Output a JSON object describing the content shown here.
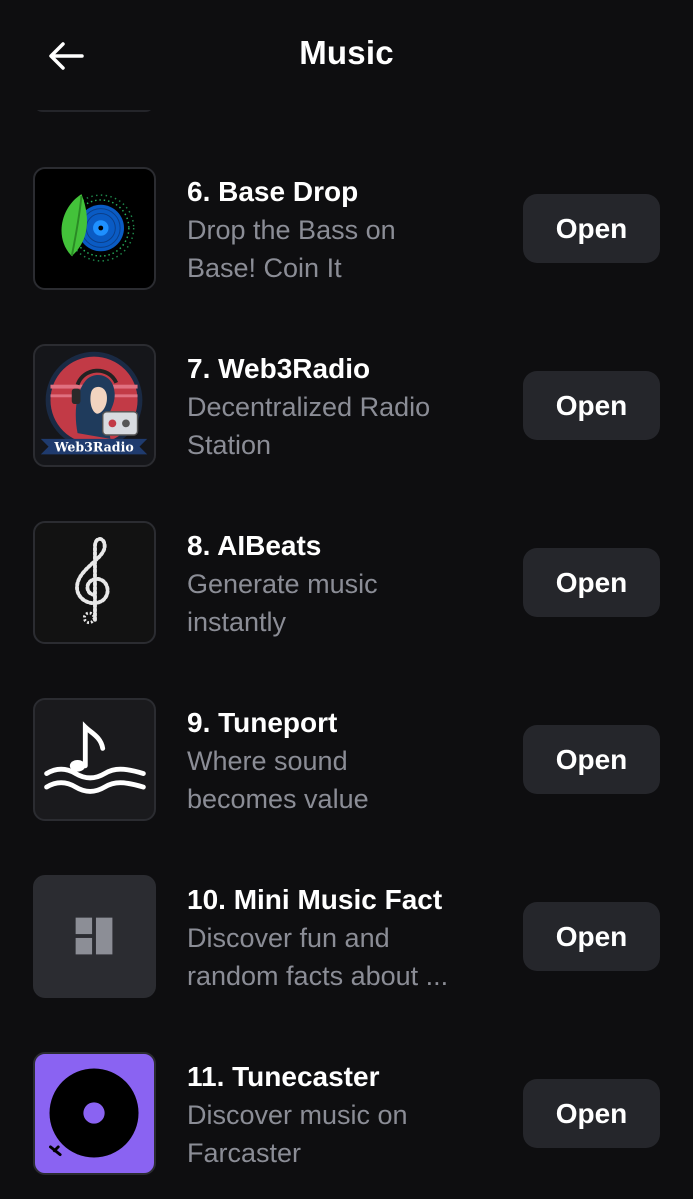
{
  "header": {
    "title": "Music",
    "back_icon": "arrow-left-icon"
  },
  "items": [
    {
      "name": "6. Base Drop",
      "desc1": "Drop the Bass on",
      "desc2": "Base! Coin It",
      "button": "Open",
      "icon": "base-drop-vinyl-leaf-icon"
    },
    {
      "name": "7. Web3Radio",
      "desc1": "Decentralized Radio",
      "desc2": "Station",
      "button": "Open",
      "icon": "web3radio-logo",
      "logo_text": "Web3Radio"
    },
    {
      "name": "8. AIBeats",
      "desc1": "Generate music",
      "desc2": "instantly",
      "button": "Open",
      "icon": "treble-clef-icon"
    },
    {
      "name": "9. Tuneport",
      "desc1": "Where sound",
      "desc2": "becomes value",
      "button": "Open",
      "icon": "music-note-waves-icon"
    },
    {
      "name": "10. Mini Music Fact",
      "desc1": "Discover fun and",
      "desc2": "random facts about ...",
      "button": "Open",
      "icon": "placeholder-layout-icon"
    },
    {
      "name": "11. Tunecaster",
      "desc1": "Discover music on",
      "desc2": "Farcaster",
      "button": "Open",
      "icon": "record-disc-icon"
    }
  ],
  "colors": {
    "background": "#0e0e10",
    "button_bg": "#25262b",
    "secondary_text": "#8b8d96",
    "tunecaster_purple": "#8a63f2"
  }
}
